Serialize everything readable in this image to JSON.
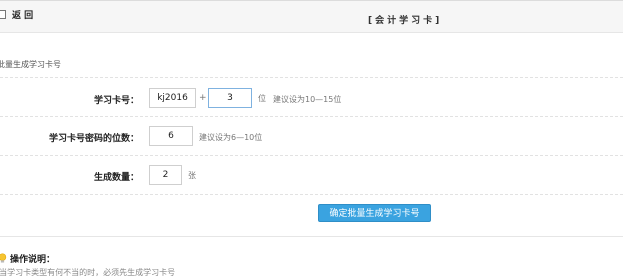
{
  "header": {
    "back_label": "返 回",
    "title": "[会计学习卡]"
  },
  "section": {
    "title": "批量生成学习卡号"
  },
  "form": {
    "card_number": {
      "label": "学习卡号：",
      "prefix_value": "kj2016",
      "plus": "+",
      "digits_value": "3",
      "unit": "位",
      "hint": "建议设为10—15位"
    },
    "password_digits": {
      "label": "学习卡号密码的位数：",
      "value": "6",
      "hint": "建议设为6—10位"
    },
    "quantity": {
      "label": "生成数量：",
      "value": "2",
      "unit": "张"
    },
    "submit_label": "确定批量生成学习卡号"
  },
  "notes": {
    "title": "操作说明：",
    "line1": "· 当学习卡类型有何不当的时，必须先生成学习卡号"
  }
}
